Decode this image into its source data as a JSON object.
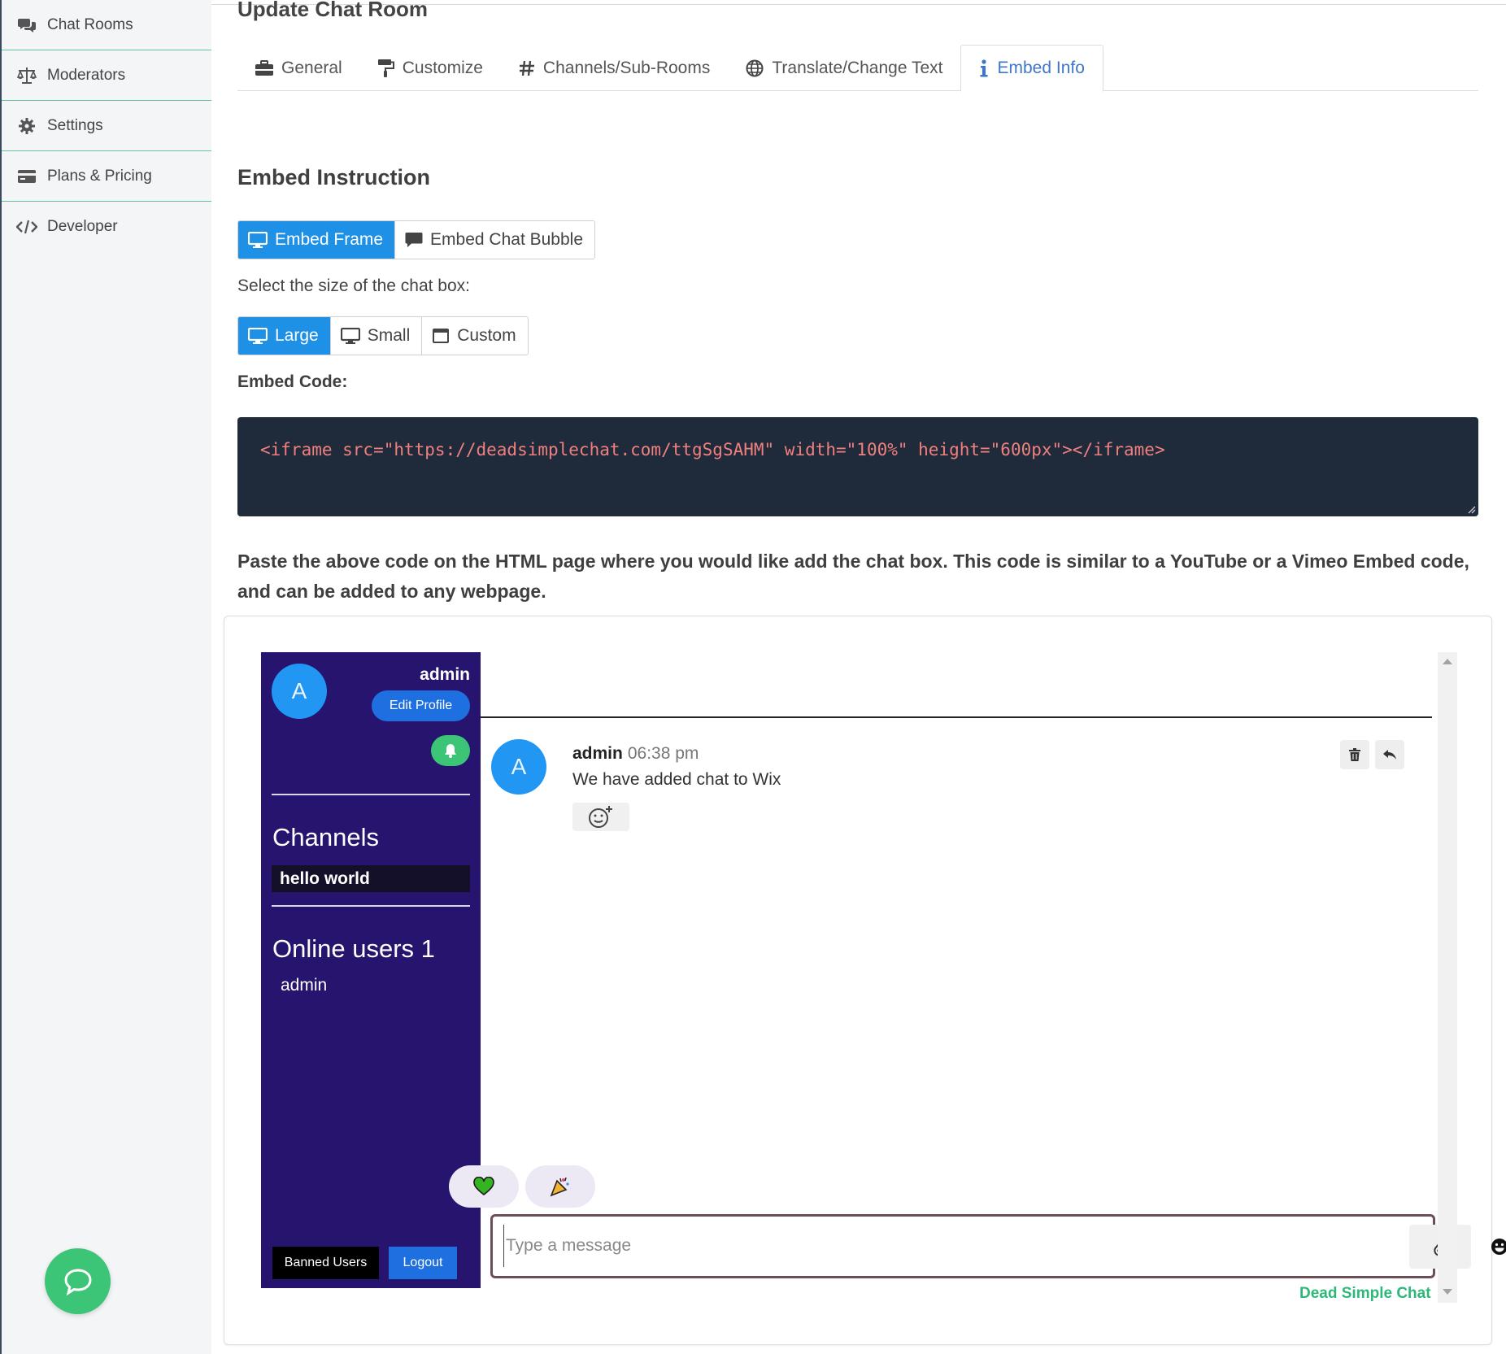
{
  "sidebar": {
    "items": [
      {
        "label": "Chat Rooms",
        "icon": "chat-bubbles-icon"
      },
      {
        "label": "Moderators",
        "icon": "scale-icon"
      },
      {
        "label": "Settings",
        "icon": "gear-icon"
      },
      {
        "label": "Plans & Pricing",
        "icon": "credit-card-icon"
      },
      {
        "label": "Developer",
        "icon": "code-icon"
      }
    ]
  },
  "page": {
    "title": "Update Chat Room",
    "tabs": [
      {
        "label": "General",
        "icon": "toolbox-icon"
      },
      {
        "label": "Customize",
        "icon": "paint-roller-icon"
      },
      {
        "label": "Channels/Sub-Rooms",
        "icon": "hash-icon"
      },
      {
        "label": "Translate/Change Text",
        "icon": "globe-icon"
      },
      {
        "label": "Embed Info",
        "icon": "info-icon",
        "active": true
      }
    ],
    "accent_color": "#1e90e6"
  },
  "embed": {
    "section_title": "Embed Instruction",
    "type_options": [
      {
        "label": "Embed Frame",
        "active": true
      },
      {
        "label": "Embed Chat Bubble",
        "active": false
      }
    ],
    "size_label": "Select the size of the chat box:",
    "size_options": [
      {
        "label": "Large",
        "active": true
      },
      {
        "label": "Small",
        "active": false
      },
      {
        "label": "Custom",
        "active": false
      }
    ],
    "code_label": "Embed Code:",
    "code": "<iframe src=\"https://deadsimplechat.com/ttgSgSAHM\" width=\"100%\" height=\"600px\"></iframe>",
    "note": "Paste the above code on the HTML page where you would like add the chat box. This code is similar to a YouTube or a Vimeo Embed code, and can be added to any webpage."
  },
  "chat": {
    "user_initial": "A",
    "username": "admin",
    "edit_profile": "Edit Profile",
    "channels_heading": "Channels",
    "channels": [
      "hello world"
    ],
    "online_heading": "Online users 1",
    "online_users": [
      "admin"
    ],
    "banned_users": "Banned Users",
    "logout": "Logout",
    "message": {
      "initial": "A",
      "user": "admin",
      "time": "06:38 pm",
      "text": "We have added chat to Wix"
    },
    "input_placeholder": "Type a message",
    "brand": "Dead Simple Chat",
    "sidebar_color": "#26146f",
    "brand_color": "#2db87a"
  }
}
